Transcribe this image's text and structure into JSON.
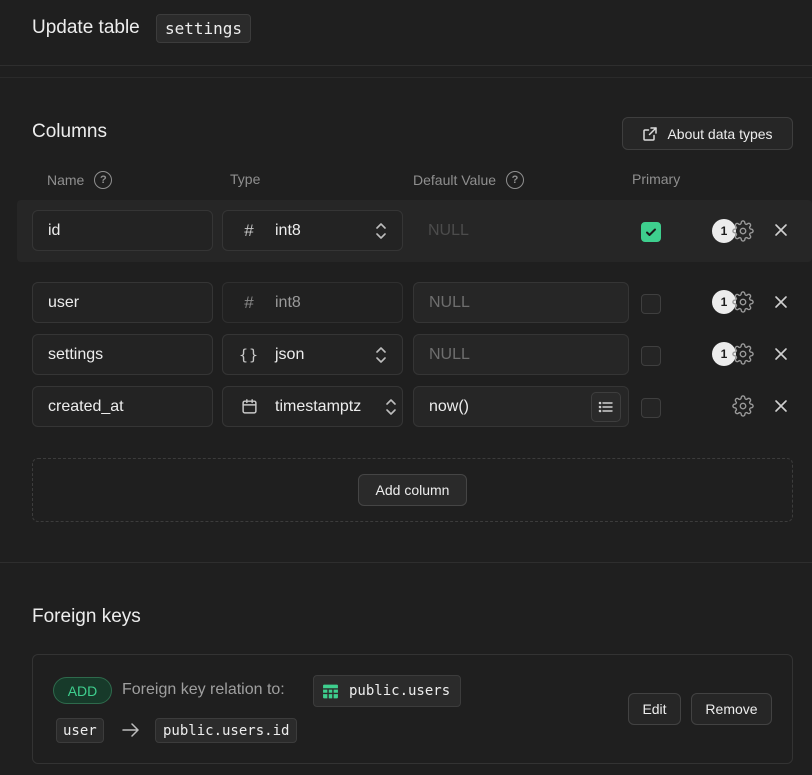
{
  "header": {
    "title": "Update table",
    "table_name": "settings"
  },
  "columns_section": {
    "title": "Columns",
    "about_button": "About data types",
    "headers": {
      "name": "Name",
      "type": "Type",
      "default_value": "Default Value",
      "primary": "Primary"
    },
    "rows": [
      {
        "name": "id",
        "type": "int8",
        "type_icon": "hash-icon",
        "default_placeholder": "NULL",
        "default_value": "",
        "primary": true,
        "badge": "1"
      },
      {
        "name": "user",
        "type": "int8",
        "type_icon": "hash-icon",
        "default_placeholder": "NULL",
        "default_value": "",
        "primary": false,
        "badge": "1"
      },
      {
        "name": "settings",
        "type": "json",
        "type_icon": "braces-icon",
        "default_placeholder": "NULL",
        "default_value": "",
        "primary": false,
        "badge": "1"
      },
      {
        "name": "created_at",
        "type": "timestamptz",
        "type_icon": "calendar-icon",
        "default_placeholder": "",
        "default_value": "now()",
        "primary": false,
        "badge": ""
      }
    ],
    "add_column_button": "Add column"
  },
  "foreign_keys": {
    "title": "Foreign keys",
    "badge": "ADD",
    "relation_text": "Foreign key relation to:",
    "target_table": "public.users",
    "source_column": "user",
    "target_column": "public.users.id",
    "edit_button": "Edit",
    "remove_button": "Remove"
  },
  "colors": {
    "background": "#1f1f1f",
    "accent": "#3ecf8e",
    "text": "#ededed",
    "muted": "#8f8f8f"
  }
}
